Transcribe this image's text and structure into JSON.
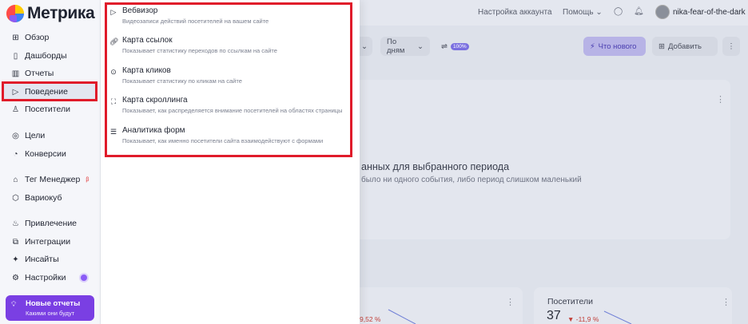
{
  "brand": {
    "name": "Метрика"
  },
  "sidebar": {
    "items": [
      {
        "label": "Обзор",
        "icon": "grid-icon"
      },
      {
        "label": "Дашборды",
        "icon": "dashboards-icon"
      },
      {
        "label": "Отчеты",
        "icon": "bar-chart-icon"
      },
      {
        "label": "Поведение",
        "icon": "play-icon"
      },
      {
        "label": "Посетители",
        "icon": "person-icon"
      },
      {
        "label": "Цели",
        "icon": "target-icon"
      },
      {
        "label": "Конверсии",
        "icon": "funnel-icon"
      },
      {
        "label": "Тег Менеджер",
        "icon": "tag-icon",
        "badge": "β"
      },
      {
        "label": "Вариокуб",
        "icon": "cube-icon"
      },
      {
        "label": "Привлечение",
        "icon": "flame-icon"
      },
      {
        "label": "Интеграции",
        "icon": "puzzle-icon"
      },
      {
        "label": "Инсайты",
        "icon": "sparkle-icon"
      },
      {
        "label": "Настройки",
        "icon": "gear-icon"
      }
    ],
    "promo": {
      "title": "Новые отчеты",
      "subtitle": "Какими они будут"
    }
  },
  "topbar": {
    "account_settings": "Настройка аккаунта",
    "help": "Помощь",
    "username": "nika-fear-of-the-dark"
  },
  "toolbar": {
    "group_by": "По дням",
    "sampling_badge": "100%",
    "whats_new": "Что нового",
    "add": "Добавить"
  },
  "empty_state": {
    "title": "анных для выбранного периода",
    "subtitle": "было ни одного события, либо период слишком маленький"
  },
  "widgets": {
    "visitors_label": "Посетители",
    "visitors_value": "37",
    "visitors_delta": "▼ -11,9 %",
    "left_delta": "9,52 %"
  },
  "behavior_menu": [
    {
      "title": "Вебвизор",
      "desc": "Видеозаписи действий посетителей на вашем сайте",
      "icon": "play-icon"
    },
    {
      "title": "Карта ссылок",
      "desc": "Показывает статистику переходов по ссылкам на сайте",
      "icon": "link-icon"
    },
    {
      "title": "Карта кликов",
      "desc": "Показывает статистику по кликам на сайте",
      "icon": "click-icon"
    },
    {
      "title": "Карта скроллинга",
      "desc": "Показывает, как распределяется внимание посетителей на областях страницы",
      "icon": "scroll-icon"
    },
    {
      "title": "Аналитика форм",
      "desc": "Показывает, как именно посетители сайта взаимодействуют с формами",
      "icon": "form-icon"
    }
  ],
  "colors": {
    "accent": "#7a3fe3",
    "highlight": "#e01b2a",
    "negative": "#c2413a"
  }
}
